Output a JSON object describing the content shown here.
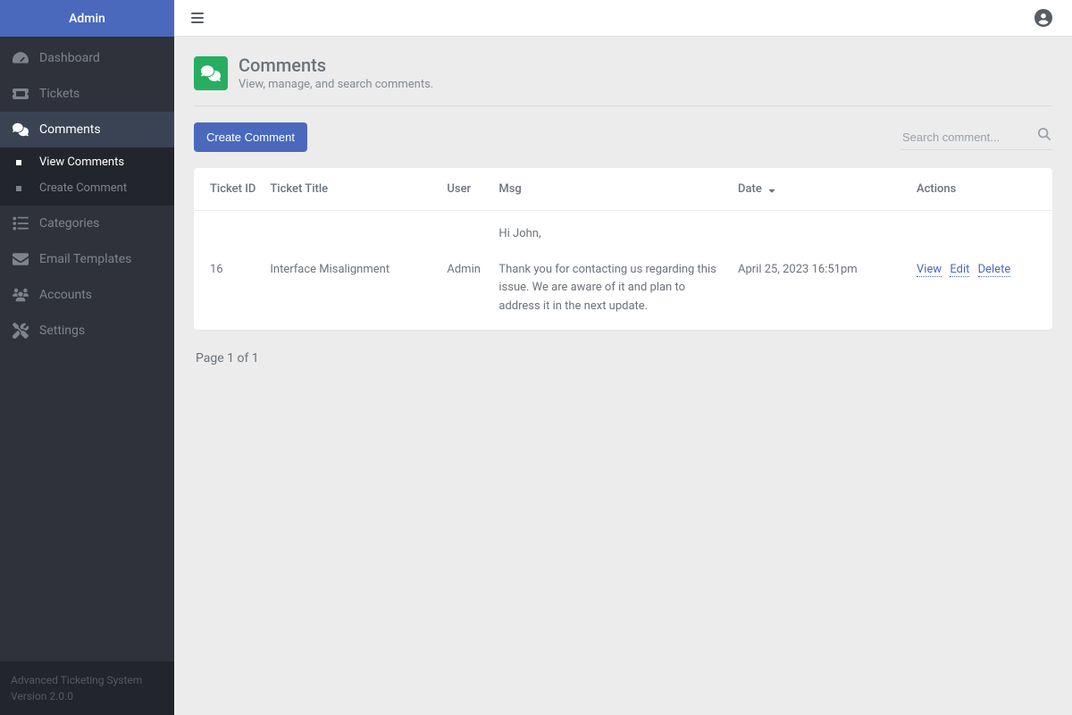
{
  "sidebar": {
    "title": "Admin",
    "items": [
      {
        "label": "Dashboard"
      },
      {
        "label": "Tickets"
      },
      {
        "label": "Comments"
      },
      {
        "label": "Categories"
      },
      {
        "label": "Email Templates"
      },
      {
        "label": "Accounts"
      },
      {
        "label": "Settings"
      }
    ],
    "comments_submenu": [
      {
        "label": "View Comments"
      },
      {
        "label": "Create Comment"
      }
    ],
    "footer_title": "Advanced Ticketing System",
    "footer_version": "Version 2.0.0"
  },
  "page": {
    "title": "Comments",
    "subtitle": "View, manage, and search comments."
  },
  "actions": {
    "create_label": "Create Comment"
  },
  "search": {
    "placeholder": "Search comment..."
  },
  "table": {
    "headers": {
      "ticket_id": "Ticket ID",
      "ticket_title": "Ticket Title",
      "user": "User",
      "msg": "Msg",
      "date": "Date",
      "actions": "Actions"
    },
    "rows": [
      {
        "ticket_id": "16",
        "ticket_title": "Interface Misalignment",
        "user": "Admin",
        "msg": "Hi John,\n\nThank you for contacting us regarding this issue. We are aware of it and plan to address it in the next update.",
        "date": "April 25, 2023 16:51pm",
        "actions": {
          "view": "View",
          "edit": "Edit",
          "delete": "Delete"
        }
      }
    ]
  },
  "pagination": {
    "text": "Page 1 of 1"
  }
}
